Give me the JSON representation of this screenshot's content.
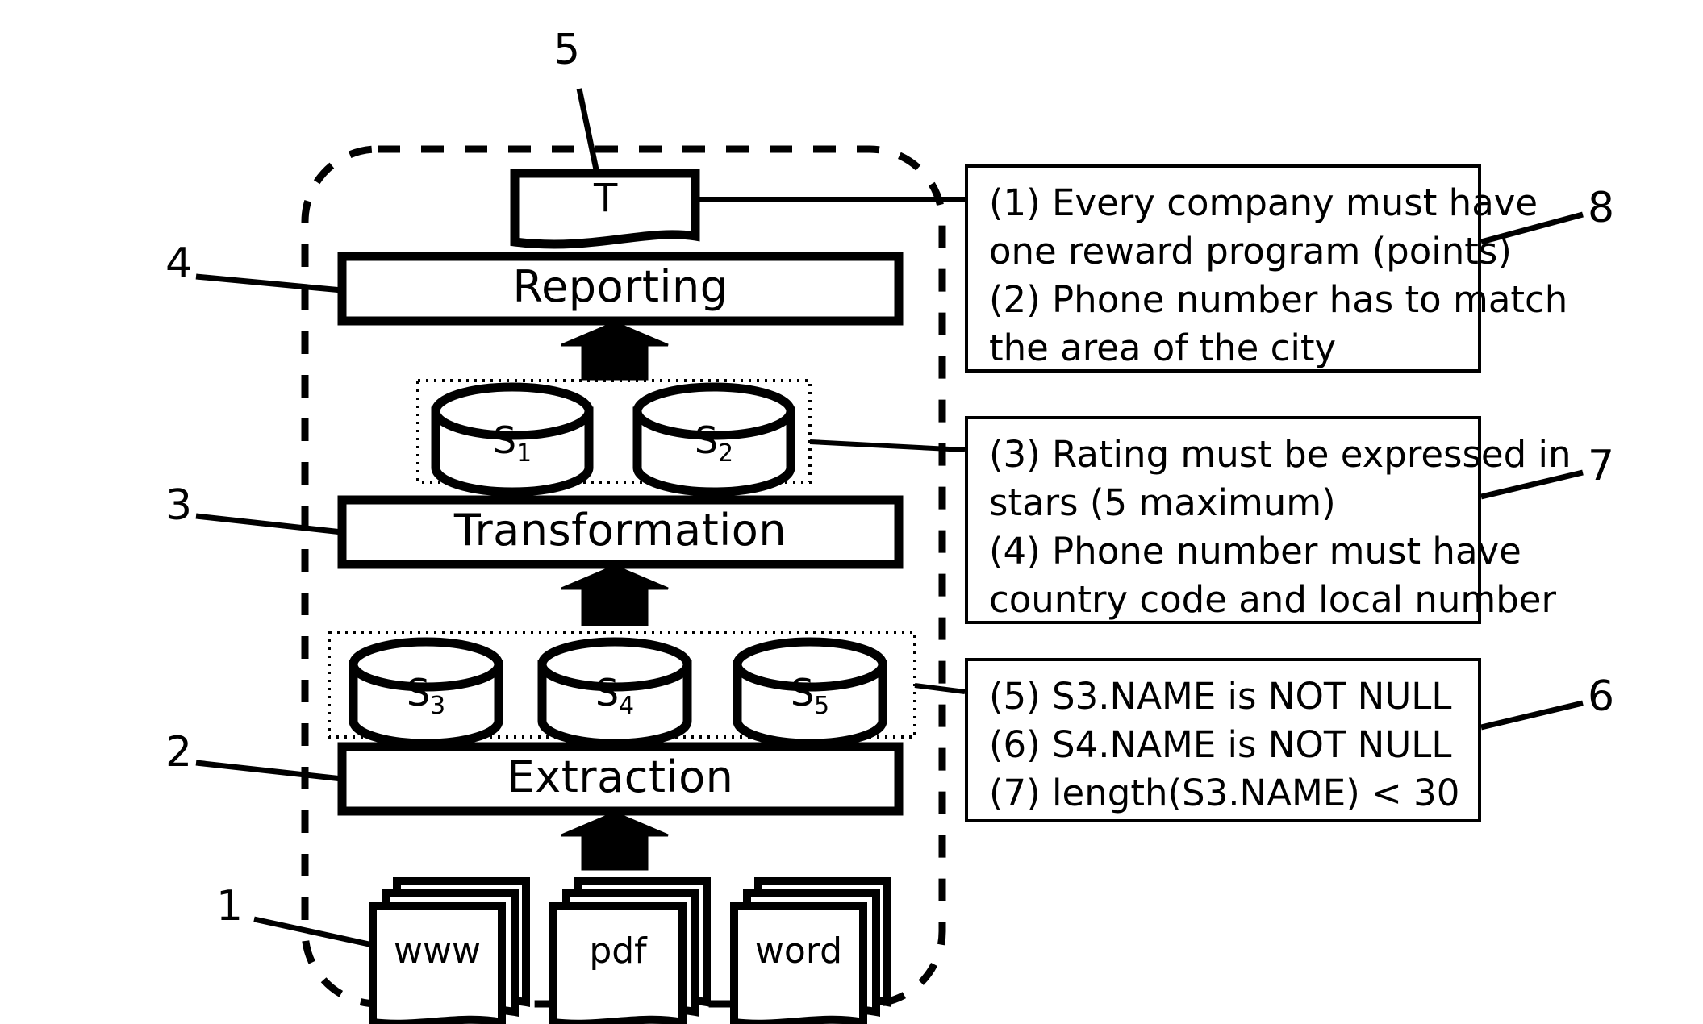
{
  "diagram": {
    "title": "ETL pipeline with data quality rules",
    "enclosure": {
      "style": "dashed-rounded-rectangle"
    },
    "pipeline_stages": [
      {
        "ref": "4",
        "label": "Reporting"
      },
      {
        "ref": "3",
        "label": "Transformation"
      },
      {
        "ref": "2",
        "label": "Extraction"
      }
    ],
    "target": {
      "ref": "5",
      "label": "T",
      "shape": "document"
    },
    "target_stores": {
      "group_label": "",
      "items": [
        {
          "label": "S",
          "subscript": "1"
        },
        {
          "label": "S",
          "subscript": "2"
        }
      ]
    },
    "source_stores": {
      "items": [
        {
          "label": "S",
          "subscript": "3"
        },
        {
          "label": "S",
          "subscript": "4"
        },
        {
          "label": "S",
          "subscript": "5"
        }
      ]
    },
    "sources": {
      "ref": "1",
      "items": [
        {
          "label": "www"
        },
        {
          "label": "pdf"
        },
        {
          "label": "word"
        }
      ]
    },
    "rule_boxes": [
      {
        "ref": "8",
        "lines": [
          "(1) Every company must have",
          "one reward program (points)",
          "(2) Phone number has to match",
          "the area of the city"
        ]
      },
      {
        "ref": "7",
        "lines": [
          "(3) Rating must be expressed in",
          "stars (5 maximum)",
          "(4) Phone number must have",
          "country code and local number"
        ]
      },
      {
        "ref": "6",
        "lines": [
          "(5) S3.NAME is NOT NULL",
          "(6) S4.NAME is NOT NULL",
          "(7) length(S3.NAME) < 30"
        ]
      }
    ],
    "reference_numerals": [
      "1",
      "2",
      "3",
      "4",
      "5",
      "6",
      "7",
      "8"
    ],
    "colors": {
      "ink": "#000000",
      "paper": "#ffffff"
    }
  }
}
